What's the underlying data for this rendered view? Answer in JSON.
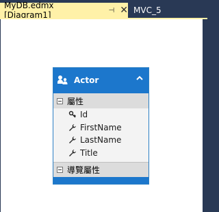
{
  "tabs": [
    {
      "label": "MyDB.edmx [Diagram1]",
      "active": true
    },
    {
      "label": "MVC_5",
      "active": false
    }
  ],
  "entity": {
    "name": "Actor",
    "properties_header": "屬性",
    "properties": [
      {
        "label": "Id",
        "icon": "key-icon"
      },
      {
        "label": "FirstName",
        "icon": "wrench-icon"
      },
      {
        "label": "LastName",
        "icon": "wrench-icon"
      },
      {
        "label": "Title",
        "icon": "wrench-icon"
      }
    ],
    "nav_header": "導覽屬性"
  },
  "colors": {
    "frame": "#293955",
    "active_tab": "#fff1a8",
    "entity_header": "#1c77cc",
    "section_header": "#dcdcdc"
  }
}
